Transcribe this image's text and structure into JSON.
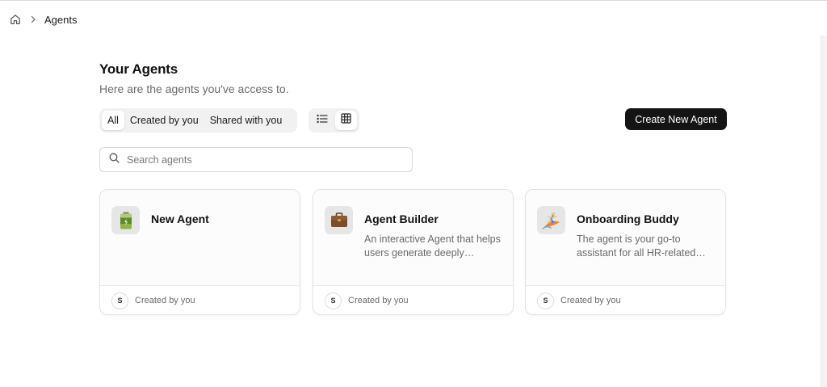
{
  "breadcrumb": {
    "home_icon": "home-icon",
    "separator_icon": "chevron-right-icon",
    "current": "Agents"
  },
  "header": {
    "title": "Your Agents",
    "subtitle": "Here are the agents you've access to."
  },
  "filters": {
    "tabs": [
      {
        "label": "All",
        "active": true
      },
      {
        "label": "Created by you",
        "active": false
      },
      {
        "label": "Shared with you",
        "active": false
      }
    ]
  },
  "view_toggle": {
    "options": [
      {
        "icon": "list-icon",
        "active": false
      },
      {
        "icon": "grid-icon",
        "active": true
      }
    ]
  },
  "actions": {
    "create_label": "Create New Agent"
  },
  "search": {
    "placeholder": "Search agents",
    "value": ""
  },
  "agents": [
    {
      "name": "New Agent",
      "description": "",
      "icon": "battery-icon",
      "avatar_initial": "S",
      "creator": "Created by you"
    },
    {
      "name": "Agent Builder",
      "description": "An interactive Agent that helps users generate deeply personalized agents",
      "icon": "briefcase-icon",
      "avatar_initial": "S",
      "creator": "Created by you"
    },
    {
      "name": "Onboarding Buddy",
      "description": "The agent is your go-to assistant for all HR-related questions",
      "icon": "surfer-icon",
      "avatar_initial": "S",
      "creator": "Created by you"
    }
  ],
  "colors": {
    "primary_button": "#141414",
    "muted_text": "#6b6b6b",
    "border": "#e3e3e3"
  }
}
